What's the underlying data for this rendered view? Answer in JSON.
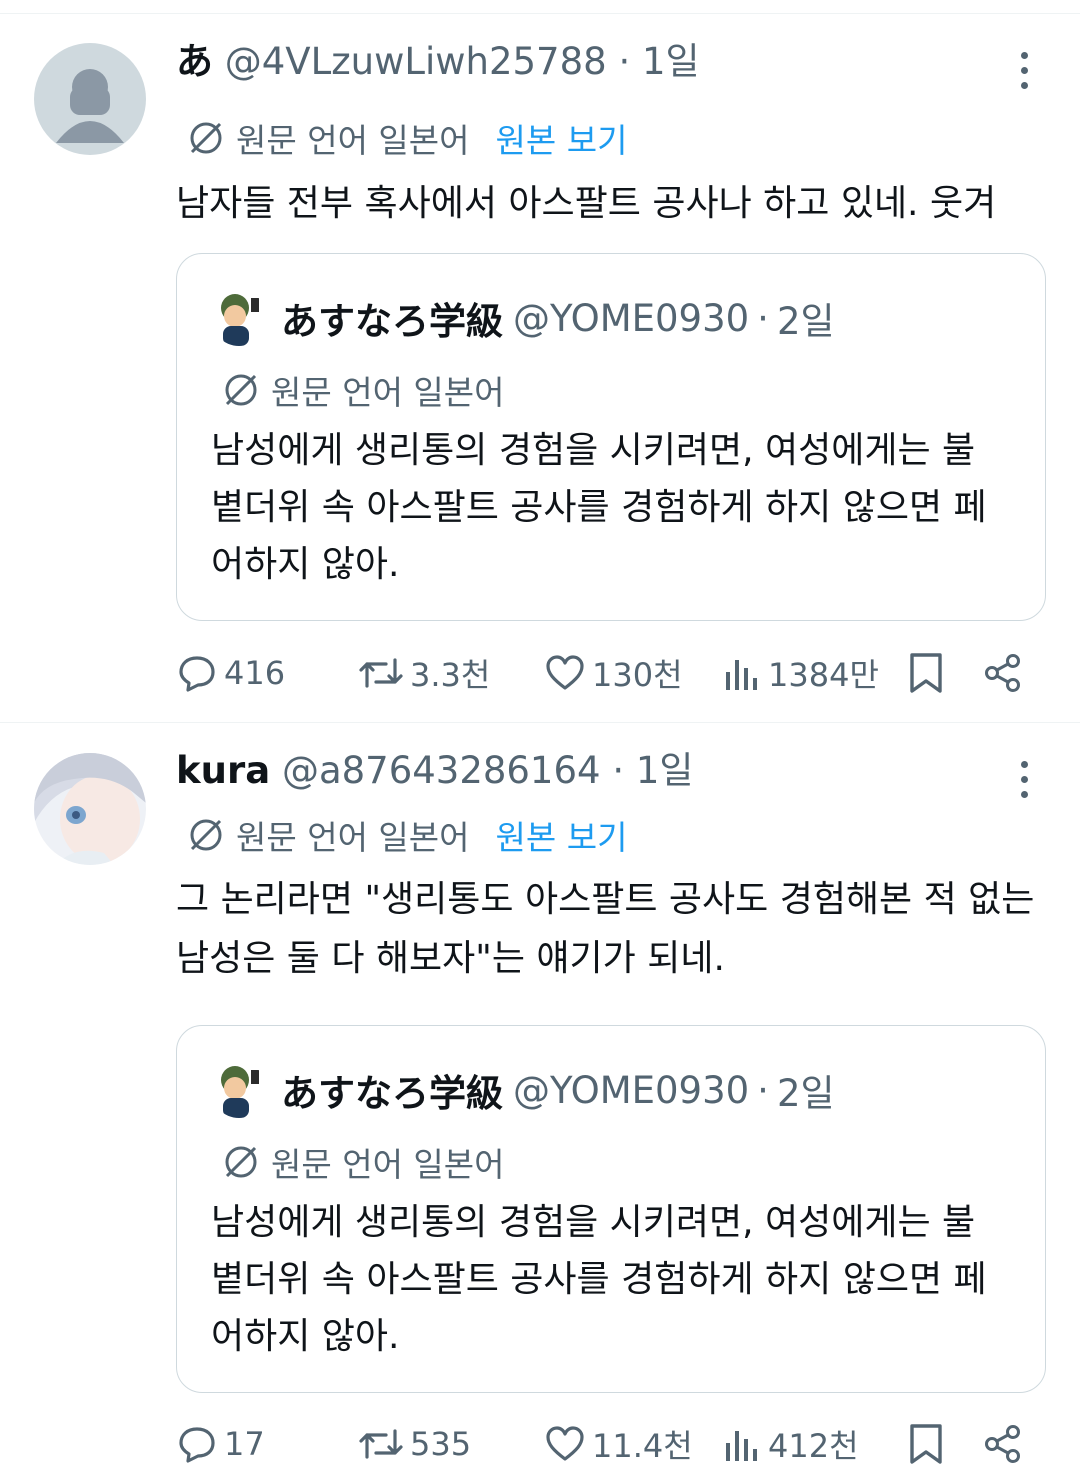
{
  "tweets": [
    {
      "display_name": "あ",
      "handle": "@4VLzuwLiwh25788",
      "separator": "·",
      "time": "1일",
      "translation": {
        "label": "원문 언어 일본어",
        "show_original": "원본 보기"
      },
      "text": "남자들 전부 혹사에서 아스팔트 공사나 하고 있네. 웃겨",
      "quote": {
        "display_name": "あすなろ学級",
        "handle": "@YOME0930",
        "separator": "·",
        "time": "2일",
        "translation_label": "원문 언어 일본어",
        "text": "남성에게 생리통의 경험을 시키려면, 여성에게는 불볕더위 속 아스팔트 공사를 경험하게 하지 않으면 페어하지 않아."
      },
      "stats": {
        "replies": "416",
        "reposts": "3.3천",
        "likes": "130천",
        "views": "1384만"
      }
    },
    {
      "display_name": "kura",
      "handle": "@a87643286164",
      "separator": "·",
      "time": "1일",
      "translation": {
        "label": "원문 언어 일본어",
        "show_original": "원본 보기"
      },
      "text": "그 논리라면 \"생리통도 아스팔트 공사도 경험해본 적 없는 남성은 둘 다 해보자\"는 얘기가 되네.",
      "quote": {
        "display_name": "あすなろ学級",
        "handle": "@YOME0930",
        "separator": "·",
        "time": "2일",
        "translation_label": "원문 언어 일본어",
        "text": "남성에게 생리통의 경험을 시키려면, 여성에게는 불볕더위 속 아스팔트 공사를 경험하게 하지 않으면 페어하지 않아."
      },
      "stats": {
        "replies": "17",
        "reposts": "535",
        "likes": "11.4천",
        "views": "412천"
      }
    }
  ],
  "colors": {
    "text": "#0f1419",
    "muted": "#536471",
    "link": "#1d9bf0",
    "border": "#cfd9de",
    "divider": "#eff3f4"
  },
  "icons": [
    "more-icon",
    "translate-icon",
    "reply-icon",
    "repost-icon",
    "like-icon",
    "views-icon",
    "bookmark-icon",
    "share-icon"
  ]
}
